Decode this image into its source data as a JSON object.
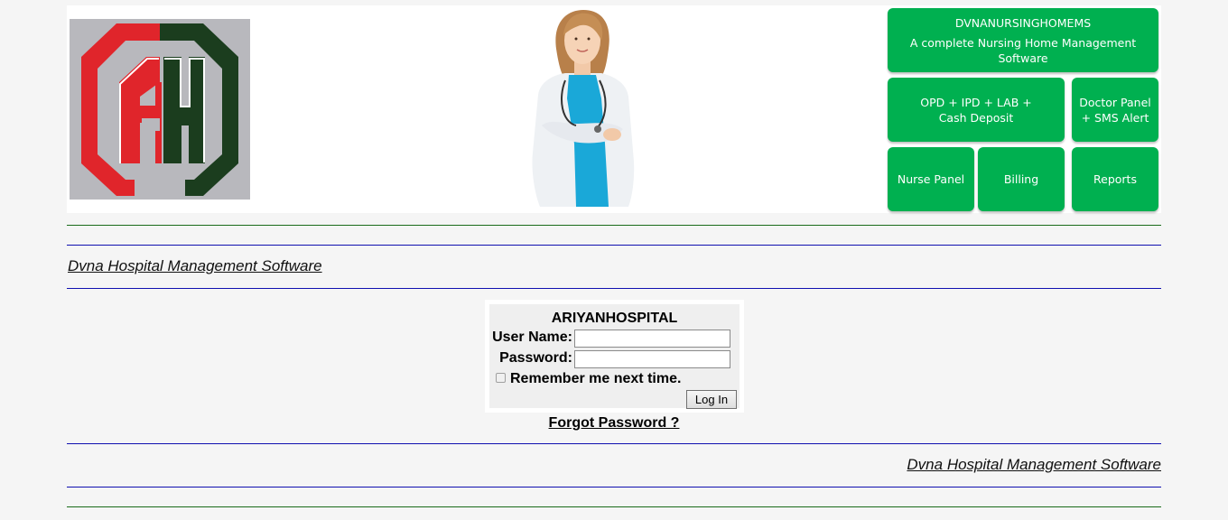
{
  "header": {
    "tiles": {
      "brand_title": "DVNANURSINGHOMEMS",
      "brand_sub": "A complete Nursing Home Management Software",
      "opd": "OPD + IPD +  LAB + Cash Deposit",
      "doctor": "Doctor Panel + SMS Alert",
      "nurse": "Nurse Panel",
      "billing": "Billing",
      "reports": "Reports"
    },
    "colors": {
      "tile_green": "#00b050",
      "logo_red": "#e0252b",
      "logo_dark_green": "#1b3d1e"
    }
  },
  "top_slogan": "Dvna Hospital Management Software",
  "bottom_slogan": "Dvna Hospital Management Software",
  "login": {
    "title": "ARIYANHOSPITAL",
    "username_label": "User Name:",
    "username_value": "",
    "password_label": "Password:",
    "password_value": "",
    "remember_label": "Remember me next time.",
    "remember_checked": false,
    "login_button": "Log In"
  },
  "forgot_password": "Forgot Password ?"
}
